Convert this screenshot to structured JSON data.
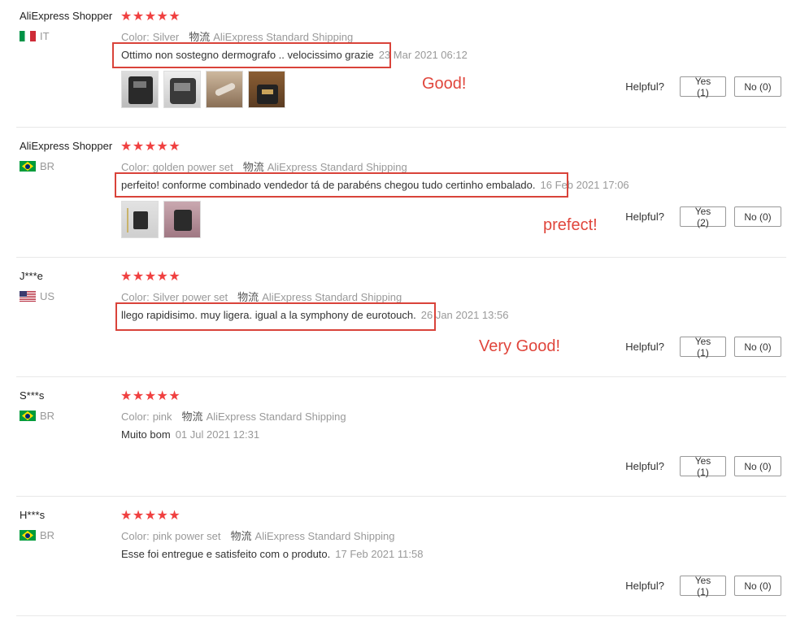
{
  "reviews": [
    {
      "user": "AliExpress Shopper",
      "country": "IT",
      "flag": "flag-it-icon",
      "color_label": "Color:",
      "color_value": "Silver",
      "ship_label": "物流",
      "ship_value": "AliExpress Standard Shipping",
      "text": "Ottimo non sostegno dermografo .. velocissimo grazie",
      "date": "23 Mar 2021 06:12",
      "annotation": "Good!",
      "thumb_count": 4,
      "helpful_label": "Helpful?",
      "yes": "Yes (1)",
      "no": "No (0)"
    },
    {
      "user": "AliExpress Shopper",
      "country": "BR",
      "flag": "flag-br-icon",
      "color_label": "Color:",
      "color_value": "golden power set",
      "ship_label": "物流",
      "ship_value": "AliExpress Standard Shipping",
      "text": "perfeito! conforme combinado vendedor tá de parabéns chegou tudo certinho embalado.",
      "date": "16 Feb 2021 17:06",
      "annotation": "prefect!",
      "thumb_count": 2,
      "helpful_label": "Helpful?",
      "yes": "Yes (2)",
      "no": "No (0)"
    },
    {
      "user": "J***e",
      "country": "US",
      "flag": "flag-us-icon",
      "color_label": "Color:",
      "color_value": "Silver power set",
      "ship_label": "物流",
      "ship_value": "AliExpress Standard Shipping",
      "text": "llego rapidisimo. muy ligera. igual a la symphony de eurotouch.",
      "date": "26 Jan 2021 13:56",
      "annotation": "Very Good!",
      "helpful_label": "Helpful?",
      "yes": "Yes (1)",
      "no": "No (0)"
    },
    {
      "user": "S***s",
      "country": "BR",
      "flag": "flag-br-icon",
      "color_label": "Color:",
      "color_value": "pink",
      "ship_label": "物流",
      "ship_value": "AliExpress Standard Shipping",
      "text": "Muito bom",
      "date": "01 Jul 2021 12:31",
      "helpful_label": "Helpful?",
      "yes": "Yes (1)",
      "no": "No (0)"
    },
    {
      "user": "H***s",
      "country": "BR",
      "flag": "flag-br-icon",
      "color_label": "Color:",
      "color_value": "pink power set",
      "ship_label": "物流",
      "ship_value": "AliExpress Standard Shipping",
      "text": "Esse foi entregue e satisfeito com o produto.",
      "date": "17 Feb 2021 11:58",
      "helpful_label": "Helpful?",
      "yes": "Yes (1)",
      "no": "No (0)"
    }
  ],
  "rating_stars": 5,
  "star_icon": "star-icon",
  "colors": {
    "star": "#f04040",
    "highlight_box": "#d9433a",
    "annotation": "#e0463c"
  }
}
